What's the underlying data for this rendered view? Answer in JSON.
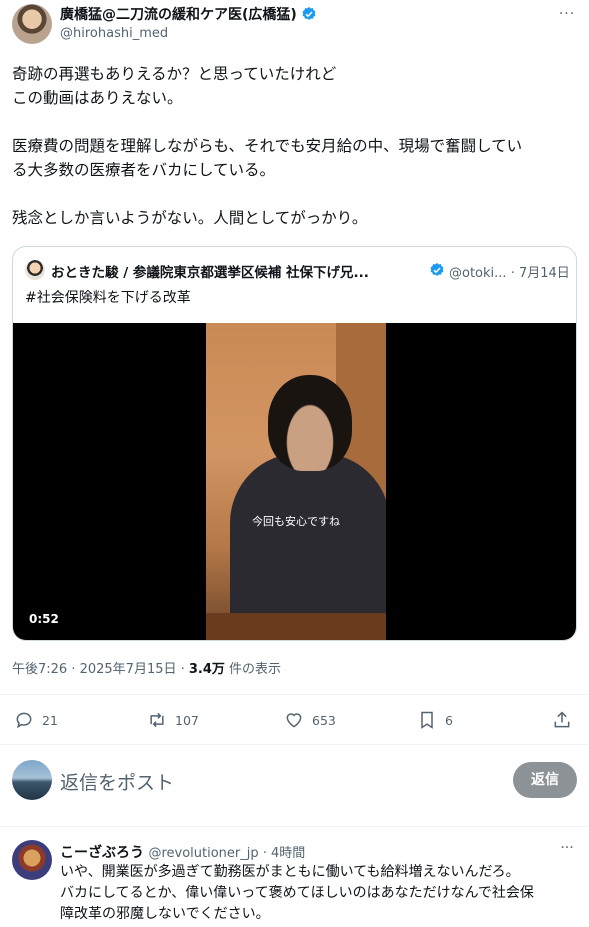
{
  "author": {
    "display_name": "廣橋猛@二刀流の緩和ケア医(広橋猛)",
    "handle": "@hirohashi_med",
    "more_label": "···"
  },
  "tweet": {
    "lines": [
      "奇跡の再選もありえるか？と思っていたけれど",
      "この動画はありえない。",
      "医療費の問題を理解しながらも、それでも安月給の中、現場で奮闘してい",
      "る大多数の医療者をバカにしている。",
      "残念としか言いようがない。人間としてがっかり。"
    ]
  },
  "quote": {
    "display_name": "おときた駿 / 参議院東京都選挙区候補 社保下げ兄...",
    "handle": "@otoki...",
    "date": "· 7月14日",
    "text": "#社会保険料を下げる改革",
    "video": {
      "caption": "今回も安心ですね",
      "duration": "0:52"
    }
  },
  "meta": {
    "timestamp": "午後7:26 · 2025年7月15日 · ",
    "views": "3.4万",
    "views_label": " 件の表示"
  },
  "actions": {
    "replies": "21",
    "reposts": "107",
    "likes": "653",
    "bookmarks": "6"
  },
  "reply_box": {
    "placeholder": "返信をポスト",
    "button": "返信"
  },
  "reply": {
    "display_name": "こーざぶろう",
    "handle": "@revolutioner_jp",
    "time": " · 4時間",
    "more_label": "···",
    "lines": [
      "いや、開業医が多過ぎて勤務医がまともに働いても給料増えないんだろ。",
      "バカにしてるとか、偉い偉いって褒めてほしいのはあなただけなんで社会保",
      "障改革の邪魔しないでください。"
    ]
  },
  "colors": {
    "verified": "#1d9bf0",
    "secondary_text": "#536471",
    "border": "#cfd9de",
    "reply_button": "#8d9297"
  }
}
